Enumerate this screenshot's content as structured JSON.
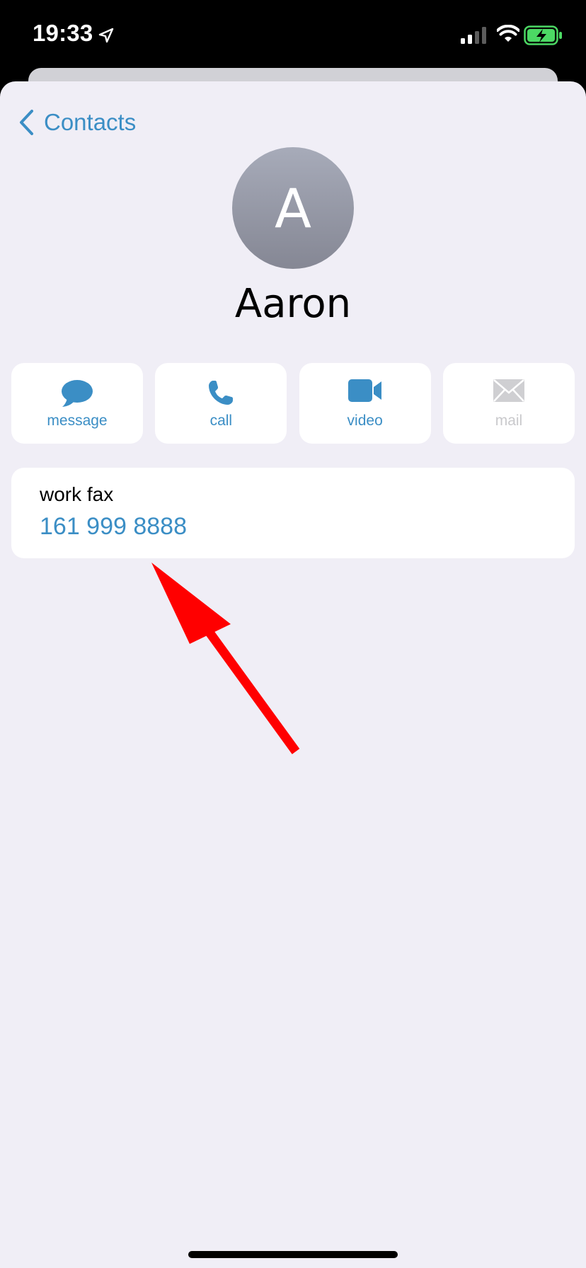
{
  "status_bar": {
    "time": "19:33"
  },
  "nav": {
    "back_label": "Contacts"
  },
  "contact": {
    "initial": "A",
    "name": "Aaron"
  },
  "actions": [
    {
      "label": "message",
      "icon": "message-bubble-icon",
      "enabled": true
    },
    {
      "label": "call",
      "icon": "phone-icon",
      "enabled": true
    },
    {
      "label": "video",
      "icon": "video-camera-icon",
      "enabled": true
    },
    {
      "label": "mail",
      "icon": "mail-envelope-icon",
      "enabled": false
    }
  ],
  "fields": [
    {
      "label": "work fax",
      "value": "161 999 8888"
    }
  ],
  "colors": {
    "accent": "#3b8ec5",
    "background": "#f0eef6",
    "annotation": "#ff0000",
    "battery": "#4cd964"
  }
}
